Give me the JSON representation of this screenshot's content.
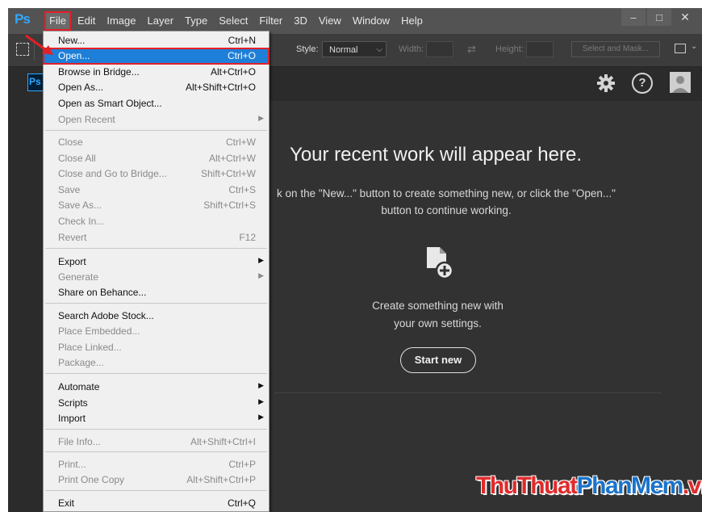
{
  "app": {
    "logo": "Ps",
    "menu": [
      "File",
      "Edit",
      "Image",
      "Layer",
      "Type",
      "Select",
      "Filter",
      "3D",
      "View",
      "Window",
      "Help"
    ],
    "window_controls": [
      "–",
      "□",
      "✕"
    ]
  },
  "options_bar": {
    "style_label": "Style:",
    "style_value": "Normal",
    "width_label": "Width:",
    "height_label": "Height:",
    "select_mask": "Select and Mask..."
  },
  "start": {
    "badge": "Ps",
    "help": "?",
    "title": "Your recent work will appear here.",
    "desc_line1": "k on the \"New...\" button to create something new, or click the \"Open...\"",
    "desc_line2": "button to continue working.",
    "create_line1": "Create something new with",
    "create_line2": "your own settings.",
    "start_new": "Start new"
  },
  "file_menu": {
    "items": [
      {
        "label": "New...",
        "shortcut": "Ctrl+N"
      },
      {
        "label": "Open...",
        "shortcut": "Ctrl+O"
      },
      {
        "label": "Browse in Bridge...",
        "shortcut": "Alt+Ctrl+O"
      },
      {
        "label": "Open As...",
        "shortcut": "Alt+Shift+Ctrl+O"
      },
      {
        "label": "Open as Smart Object...",
        "shortcut": ""
      },
      {
        "label": "Open Recent",
        "shortcut": ""
      },
      {
        "label": "Close",
        "shortcut": "Ctrl+W"
      },
      {
        "label": "Close All",
        "shortcut": "Alt+Ctrl+W"
      },
      {
        "label": "Close and Go to Bridge...",
        "shortcut": "Shift+Ctrl+W"
      },
      {
        "label": "Save",
        "shortcut": "Ctrl+S"
      },
      {
        "label": "Save As...",
        "shortcut": "Shift+Ctrl+S"
      },
      {
        "label": "Check In...",
        "shortcut": ""
      },
      {
        "label": "Revert",
        "shortcut": "F12"
      },
      {
        "label": "Export",
        "shortcut": ""
      },
      {
        "label": "Generate",
        "shortcut": ""
      },
      {
        "label": "Share on Behance...",
        "shortcut": ""
      },
      {
        "label": "Search Adobe Stock...",
        "shortcut": ""
      },
      {
        "label": "Place Embedded...",
        "shortcut": ""
      },
      {
        "label": "Place Linked...",
        "shortcut": ""
      },
      {
        "label": "Package...",
        "shortcut": ""
      },
      {
        "label": "Automate",
        "shortcut": ""
      },
      {
        "label": "Scripts",
        "shortcut": ""
      },
      {
        "label": "Import",
        "shortcut": ""
      },
      {
        "label": "File Info...",
        "shortcut": "Alt+Shift+Ctrl+I"
      },
      {
        "label": "Print...",
        "shortcut": "Ctrl+P"
      },
      {
        "label": "Print One Copy",
        "shortcut": "Alt+Shift+Ctrl+P"
      },
      {
        "label": "Exit",
        "shortcut": "Ctrl+Q"
      }
    ]
  },
  "watermark": {
    "part1": "ThuThuat",
    "part2": "PhanMem",
    "part3": ".vn"
  },
  "colors": {
    "highlight": "#1e7fd8",
    "annotation": "#e32027",
    "ps_blue": "#31a8ff"
  }
}
